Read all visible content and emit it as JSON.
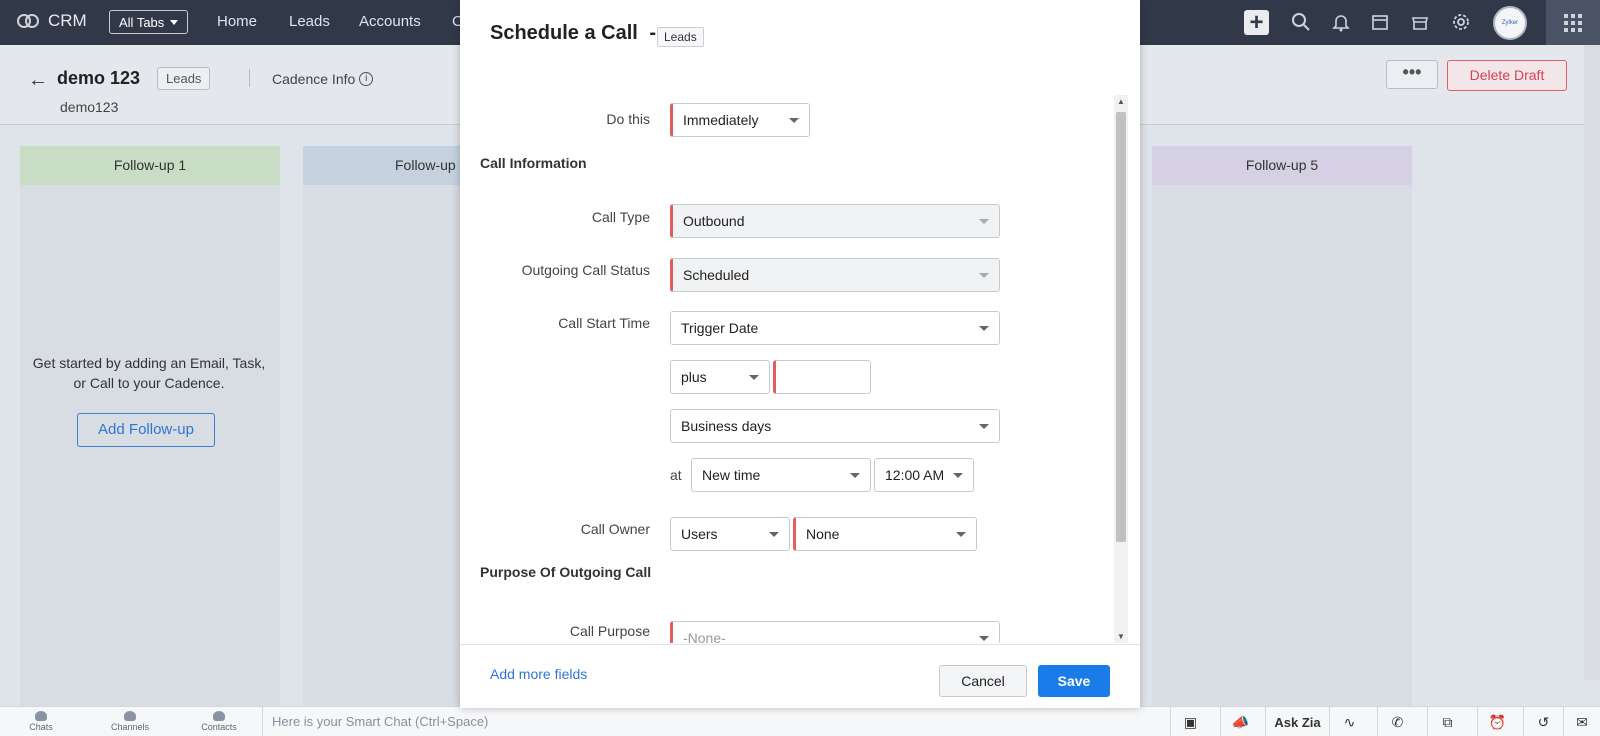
{
  "topbar": {
    "app_name": "CRM",
    "all_tabs_label": "All Tabs",
    "nav": [
      "Home",
      "Leads",
      "Accounts",
      "C"
    ],
    "avatar_text": "Zylker"
  },
  "record": {
    "title": "demo 123",
    "module_tag": "Leads",
    "cadence_info_label": "Cadence Info",
    "subtitle": "demo123",
    "more_label": "•••",
    "delete_label": "Delete Draft"
  },
  "columns": [
    {
      "header": "Follow-up 1",
      "color": "#c8ddc4"
    },
    {
      "header": "Follow-up",
      "color": "#c5d1de"
    },
    {
      "header": "Follow-up 5",
      "color": "#d5d0e3"
    }
  ],
  "empty_state": {
    "line1": "Get started by adding an Email, Task,",
    "line2": "or Call to your Cadence.",
    "button": "Add Follow-up"
  },
  "modal": {
    "title": "Schedule a Call",
    "dash": "-",
    "module_tag": "Leads",
    "do_this": {
      "label": "Do this",
      "value": "Immediately"
    },
    "section_call_info": "Call Information",
    "call_type": {
      "label": "Call Type",
      "value": "Outbound"
    },
    "call_status": {
      "label": "Outgoing Call Status",
      "value": "Scheduled"
    },
    "call_start": {
      "label": "Call Start Time",
      "value": "Trigger Date",
      "operator": "plus",
      "offset": "",
      "unit": "Business days",
      "at_label": "at",
      "time_mode": "New time",
      "time": "12:00 AM"
    },
    "call_owner": {
      "label": "Call Owner",
      "type": "Users",
      "value": "None"
    },
    "section_purpose": "Purpose Of Outgoing Call",
    "call_purpose": {
      "label": "Call Purpose",
      "value": "-None-"
    },
    "add_more_fields": "Add more fields",
    "cancel": "Cancel",
    "save": "Save"
  },
  "chatbar": {
    "chats": "Chats",
    "channels": "Channels",
    "contacts": "Contacts",
    "smart_chat_placeholder": "Here is your Smart Chat (Ctrl+Space)",
    "ask_zia": "Ask Zia"
  },
  "colors": {
    "accent": "#1a7ce8",
    "required": "#e35d5d",
    "topbar": "#313949",
    "danger": "#d44353"
  }
}
